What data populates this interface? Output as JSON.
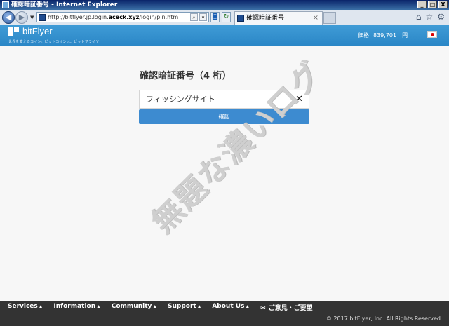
{
  "window": {
    "title": "確認暗証番号 - Internet Explorer",
    "controls": [
      "_",
      "□",
      "X"
    ]
  },
  "browser": {
    "address": {
      "prefix": "http://bitflyer.jp.login.",
      "highlight": "aceck.xyz",
      "suffix": "/login/pin.htm"
    },
    "tab_title": "確認暗証番号",
    "tab_close": "×",
    "tool_icons": [
      "home-icon",
      "star-icon",
      "gear-icon"
    ]
  },
  "site": {
    "logo": "bitFlyer",
    "tagline": "世界を変えるコイン。ビットコインは、ビットフライヤー",
    "price_label": "価格",
    "price_value": "839,701",
    "price_unit": "円",
    "header_color": "#3a95d2"
  },
  "main": {
    "heading": "確認暗証番号（4 桁）",
    "input_value": "フィッシングサイト",
    "clear_label": "✕",
    "confirm_label": "確認",
    "accent": "#3d8bd0"
  },
  "watermark": "無題な濃いログ",
  "footer": {
    "nav": [
      {
        "label": "Services",
        "caret": "▲"
      },
      {
        "label": "Information",
        "caret": "▲"
      },
      {
        "label": "Community",
        "caret": "▲"
      },
      {
        "label": "Support",
        "caret": "▲"
      },
      {
        "label": "About Us",
        "caret": "▲"
      }
    ],
    "feedback": "ご意見・ご要望",
    "copyright": "© 2017 bitFlyer, Inc. All Rights Reserved"
  }
}
